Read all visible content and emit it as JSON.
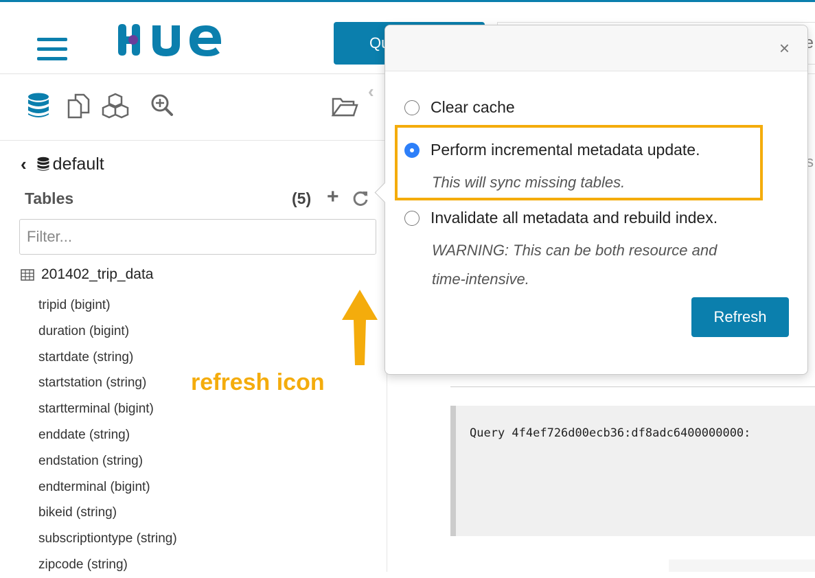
{
  "header": {
    "logo_text": "HUE",
    "query_button_label": "Qu",
    "search_tail": "e"
  },
  "sidebar": {
    "icons": [
      "database-icon",
      "documents-icon",
      "cubes-icon",
      "zoom-in-icon",
      "folder-open-icon"
    ],
    "database_name": "default",
    "tables_label": "Tables",
    "tables_count": "(5)",
    "filter_placeholder": "Filter...",
    "table_name": "201402_trip_data",
    "columns": [
      "tripid (bigint)",
      "duration (bigint)",
      "startdate (string)",
      "startstation (string)",
      "startterminal (bigint)",
      "enddate (string)",
      "endstation (string)",
      "endterminal (bigint)",
      "bikeid (string)",
      "subscriptiontype (string)",
      "zipcode (string)"
    ]
  },
  "annotation": {
    "label": "refresh icon",
    "color": "#f4ac0c"
  },
  "popover": {
    "close_label": "×",
    "options": [
      {
        "label": "Clear cache",
        "selected": false,
        "description": ""
      },
      {
        "label": "Perform incremental metadata update.",
        "selected": true,
        "description": "This will sync missing tables."
      },
      {
        "label": "Invalidate all metadata and rebuild index.",
        "selected": false,
        "description_line1": "WARNING: This can be both resource and",
        "description_line2": "time-intensive."
      }
    ],
    "action_label": "Refresh"
  },
  "content": {
    "side_text": "s",
    "query_line": "Query 4f4ef726d00ecb36:df8adc6400000000:"
  },
  "colors": {
    "brand": "#0b7fad",
    "radio_selected": "#2d7ff9",
    "highlight": "#f4ac0c"
  }
}
